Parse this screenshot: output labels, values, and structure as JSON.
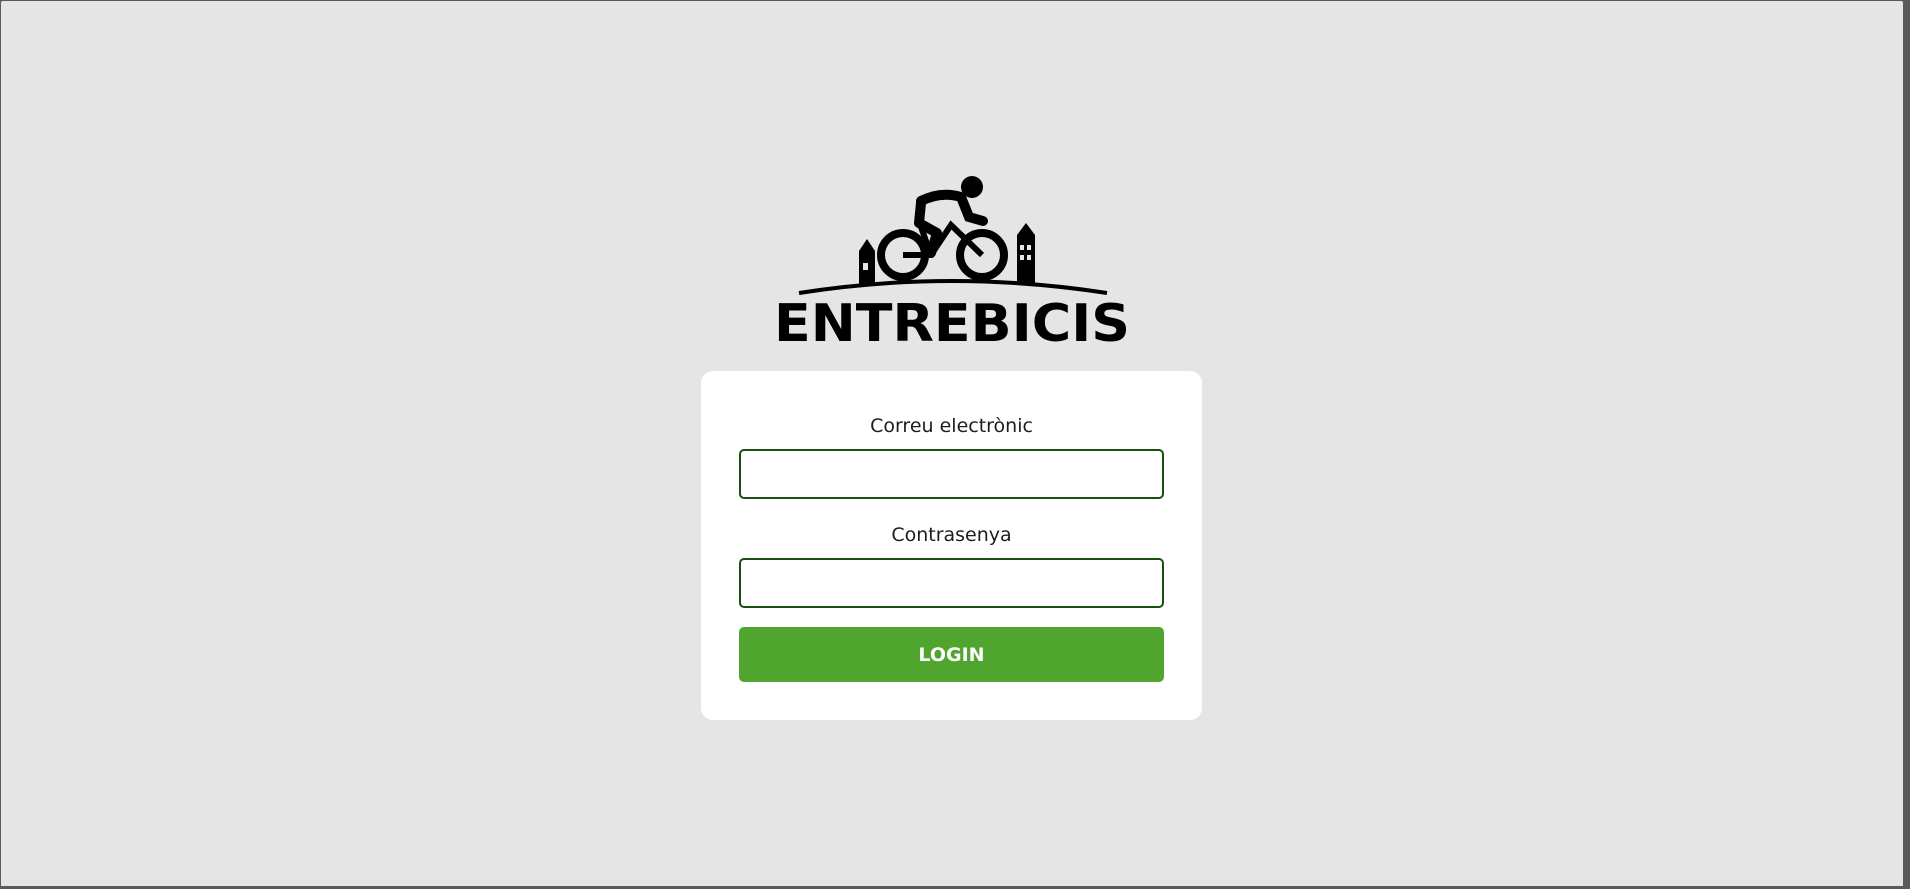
{
  "brand": {
    "name": "ENTREBICIS",
    "logo_icon": "cyclist-city-logo"
  },
  "login_form": {
    "email_label": "Correu electrònic",
    "email_value": "",
    "email_placeholder": "",
    "password_label": "Contrasenya",
    "password_value": "",
    "password_placeholder": "",
    "submit_label": "LOGIN"
  },
  "colors": {
    "background": "#e5e5e5",
    "card": "#ffffff",
    "input_border": "#1b4f12",
    "button": "#4fa52e",
    "button_text": "#ffffff"
  }
}
